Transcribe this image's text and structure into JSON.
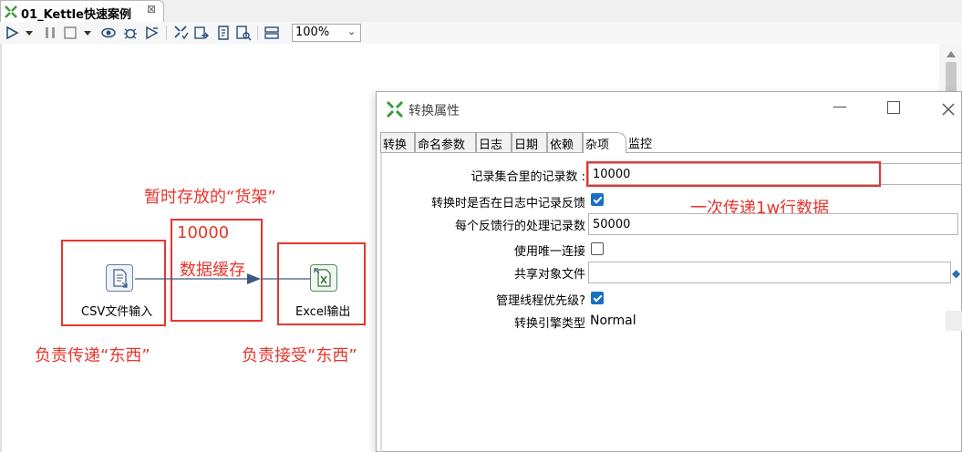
{
  "tab": {
    "title": "01_Kettle快速案例",
    "close_glyph": "⊠"
  },
  "toolbar": {
    "zoom": "100%"
  },
  "canvas": {
    "annotations": {
      "shelf_title": "暂时存放的“货架”",
      "buffer_count": "10000",
      "buffer_label": "数据缓存",
      "left_note": "负责传递“东西”",
      "right_note": "负责接受“东西”",
      "dialog_note": "一次传递1w行数据"
    },
    "steps": {
      "csv_label": "CSV文件输入",
      "excel_label": "Excel输出"
    },
    "accent_color": "#e8352e"
  },
  "dialog": {
    "title": "转换属性",
    "tabs": [
      "转换",
      "命名参数",
      "日志",
      "日期",
      "依赖",
      "杂项",
      "监控"
    ],
    "active_tab": "杂项",
    "fields": {
      "rowset_size_label": "记录集合里的记录数 :",
      "rowset_size_value": "10000",
      "feedback_label": "转换时是否在日志中记录反馈",
      "feedback_checked": true,
      "feedback_size_label": "每个反馈行的处理记录数",
      "feedback_size_value": "50000",
      "unique_conn_label": "使用唯一连接",
      "unique_conn_checked": false,
      "shared_file_label": "共享对象文件",
      "shared_file_value": "",
      "thread_priority_label": "管理线程优先级?",
      "thread_priority_checked": true,
      "engine_type_label": "转换引擎类型",
      "engine_type_value": "Normal"
    }
  }
}
